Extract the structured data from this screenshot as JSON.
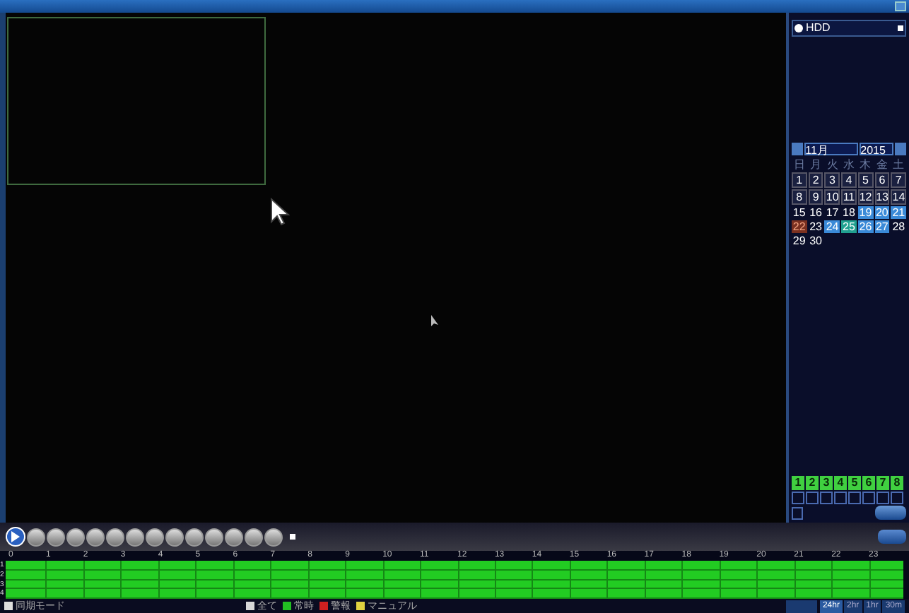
{
  "storage": {
    "value": "HDD",
    "selected": true
  },
  "calendar": {
    "month": "11月",
    "year": "2015",
    "weekdays": [
      "日",
      "月",
      "火",
      "水",
      "木",
      "金",
      "土"
    ],
    "days": [
      {
        "label": "1",
        "kind": "record"
      },
      {
        "label": "2",
        "kind": "record"
      },
      {
        "label": "3",
        "kind": "record"
      },
      {
        "label": "4",
        "kind": "record"
      },
      {
        "label": "5",
        "kind": "record"
      },
      {
        "label": "6",
        "kind": "record"
      },
      {
        "label": "7",
        "kind": "record"
      },
      {
        "label": "8",
        "kind": "record"
      },
      {
        "label": "9",
        "kind": "record"
      },
      {
        "label": "10",
        "kind": "record"
      },
      {
        "label": "11",
        "kind": "record"
      },
      {
        "label": "12",
        "kind": "record"
      },
      {
        "label": "13",
        "kind": "record"
      },
      {
        "label": "14",
        "kind": "record"
      },
      {
        "label": "15",
        "kind": "plain"
      },
      {
        "label": "16",
        "kind": "plain"
      },
      {
        "label": "17",
        "kind": "plain"
      },
      {
        "label": "18",
        "kind": "plain"
      },
      {
        "label": "19",
        "kind": "highlight"
      },
      {
        "label": "20",
        "kind": "highlight"
      },
      {
        "label": "21",
        "kind": "highlight"
      },
      {
        "label": "22",
        "kind": "selected"
      },
      {
        "label": "23",
        "kind": "plain"
      },
      {
        "label": "24",
        "kind": "highlight"
      },
      {
        "label": "25",
        "kind": "today"
      },
      {
        "label": "26",
        "kind": "highlight"
      },
      {
        "label": "27",
        "kind": "highlight"
      },
      {
        "label": "28",
        "kind": "plain"
      },
      {
        "label": "29",
        "kind": "plain"
      },
      {
        "label": "30",
        "kind": "plain"
      }
    ]
  },
  "channels": [
    {
      "label": "1",
      "checked": true
    },
    {
      "label": "2",
      "checked": true
    },
    {
      "label": "3",
      "checked": true
    },
    {
      "label": "4",
      "checked": true
    },
    {
      "label": "5",
      "checked": true
    },
    {
      "label": "6",
      "checked": true
    },
    {
      "label": "7",
      "checked": true
    },
    {
      "label": "8",
      "checked": true
    }
  ],
  "timeline": {
    "hours": [
      "0",
      "1",
      "2",
      "3",
      "4",
      "5",
      "6",
      "7",
      "8",
      "9",
      "10",
      "11",
      "12",
      "13",
      "14",
      "15",
      "16",
      "17",
      "18",
      "19",
      "20",
      "21",
      "22",
      "23"
    ],
    "rows": [
      {
        "label": "1"
      },
      {
        "label": "2"
      },
      {
        "label": "3"
      },
      {
        "label": "4"
      }
    ]
  },
  "mode": {
    "label": "同期モード",
    "checked": false
  },
  "legend": [
    {
      "label": "全て",
      "color": "#d8d8d8"
    },
    {
      "label": "常時",
      "color": "#22c022"
    },
    {
      "label": "警報",
      "color": "#d02020"
    },
    {
      "label": "マニュアル",
      "color": "#e0d040"
    }
  ],
  "zoom_options": [
    {
      "label": "24hr",
      "selected": true
    },
    {
      "label": "2hr",
      "selected": false
    },
    {
      "label": "1hr",
      "selected": false
    },
    {
      "label": "30m",
      "selected": false
    }
  ]
}
